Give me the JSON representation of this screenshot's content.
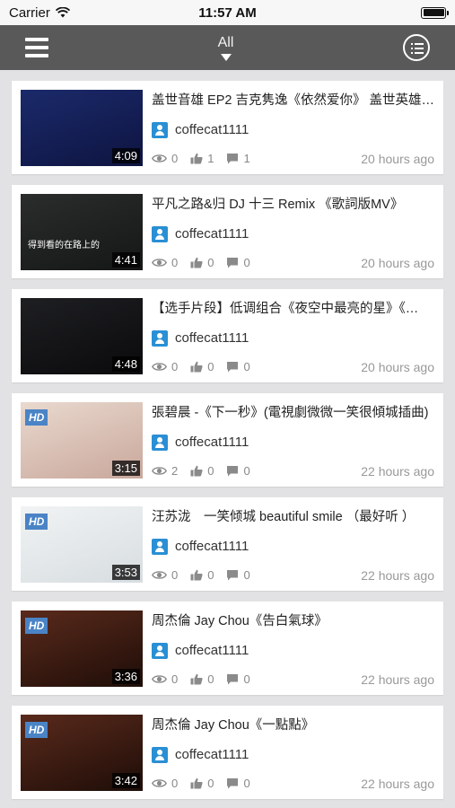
{
  "status": {
    "carrier": "Carrier",
    "time": "11:57 AM"
  },
  "nav": {
    "title": "All"
  },
  "videos": [
    {
      "title": "盖世音雄 EP2 吉克隽逸《依然爱你》 盖世英雄…",
      "author": "coffecat1111",
      "views": "0",
      "likes": "1",
      "comments": "1",
      "time_ago": "20 hours ago",
      "duration": "4:09",
      "hd": "",
      "caption": "",
      "thumb_colors": [
        "#1b2a6b",
        "#0e1440"
      ]
    },
    {
      "title": "平凡之路&归 DJ 十三 Remix 《歌詞版MV》",
      "author": "coffecat1111",
      "views": "0",
      "likes": "0",
      "comments": "0",
      "time_ago": "20 hours ago",
      "duration": "4:41",
      "hd": "",
      "caption": "得到看的在路上的",
      "thumb_colors": [
        "#2a2d2c",
        "#151716"
      ]
    },
    {
      "title": "【选手片段】低调组合《夜空中最亮的星》《…",
      "author": "coffecat1111",
      "views": "0",
      "likes": "0",
      "comments": "0",
      "time_ago": "20 hours ago",
      "duration": "4:48",
      "hd": "",
      "caption": "",
      "thumb_colors": [
        "#1e1f22",
        "#0a0a0c"
      ]
    },
    {
      "title": "張碧晨 -《下一秒》(電視劇微微一笑很傾城插曲)",
      "author": "coffecat1111",
      "views": "2",
      "likes": "0",
      "comments": "0",
      "time_ago": "22 hours ago",
      "duration": "3:15",
      "hd": "HD",
      "caption": "",
      "thumb_colors": [
        "#e9d9cf",
        "#c9a79b"
      ]
    },
    {
      "title": "汪苏泷　一笑倾城 beautiful smile （最好听 ）",
      "author": "coffecat1111",
      "views": "0",
      "likes": "0",
      "comments": "0",
      "time_ago": "22 hours ago",
      "duration": "3:53",
      "hd": "HD",
      "caption": "",
      "thumb_colors": [
        "#f1f3f4",
        "#d7dde0"
      ]
    },
    {
      "title": "周杰倫 Jay Chou《告白氣球》",
      "author": "coffecat1111",
      "views": "0",
      "likes": "0",
      "comments": "0",
      "time_ago": "22 hours ago",
      "duration": "3:36",
      "hd": "HD",
      "caption": "",
      "thumb_colors": [
        "#5a2a1c",
        "#1e0d08"
      ]
    },
    {
      "title": "周杰倫 Jay Chou《一點點》",
      "author": "coffecat1111",
      "views": "0",
      "likes": "0",
      "comments": "0",
      "time_ago": "22 hours ago",
      "duration": "3:42",
      "hd": "HD",
      "caption": "",
      "thumb_colors": [
        "#5a2a1c",
        "#1e0d08"
      ]
    }
  ]
}
